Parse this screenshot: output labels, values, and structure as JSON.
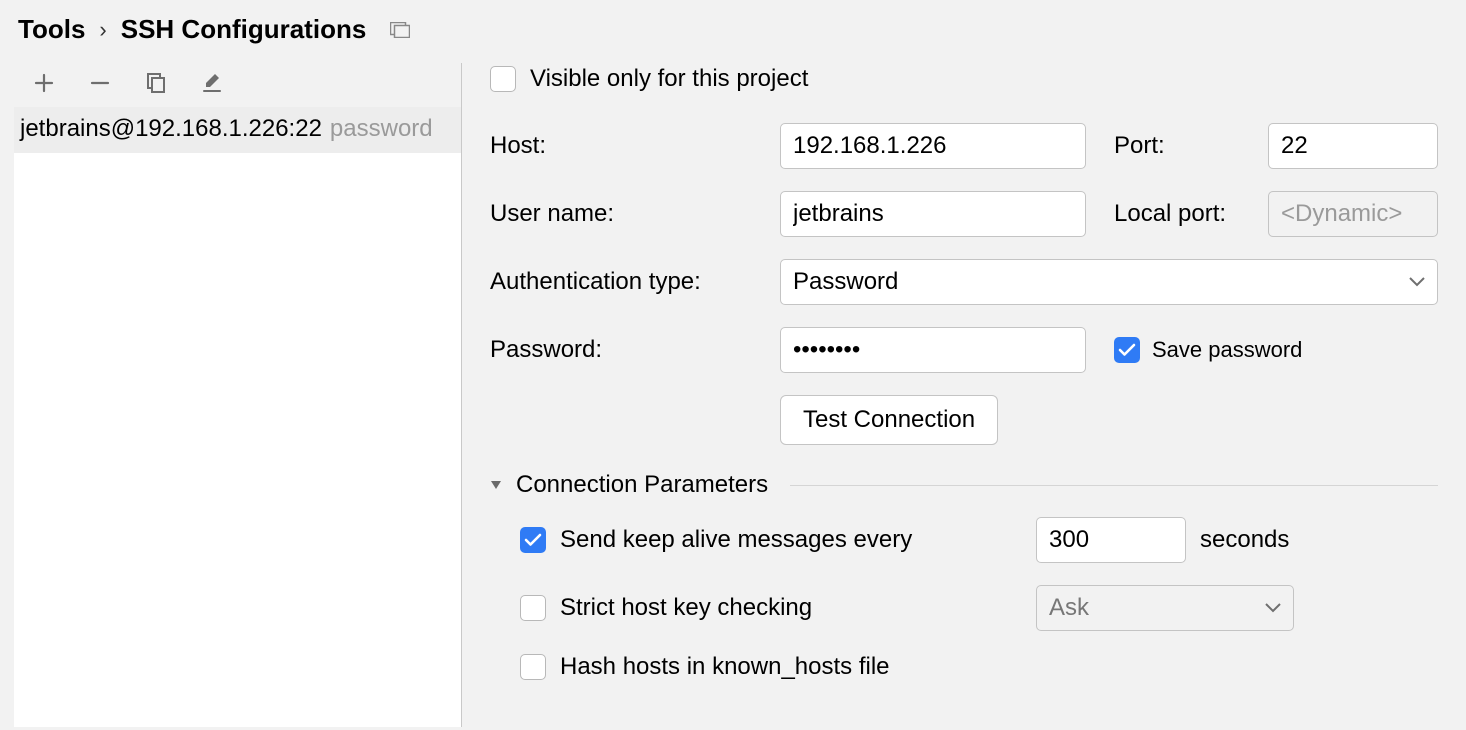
{
  "breadcrumb": {
    "tools": "Tools",
    "page": "SSH Configurations"
  },
  "sidebar": {
    "items": [
      {
        "title": "jetbrains@192.168.1.226:22",
        "auth": "password"
      }
    ]
  },
  "form": {
    "visible_only_label": "Visible only for this project",
    "visible_only_checked": false,
    "host_label": "Host:",
    "host_value": "192.168.1.226",
    "port_label": "Port:",
    "port_value": "22",
    "user_label": "User name:",
    "user_value": "jetbrains",
    "localport_label": "Local port:",
    "localport_placeholder": "<Dynamic>",
    "auth_label": "Authentication type:",
    "auth_value": "Password",
    "password_label": "Password:",
    "password_value": "••••••••",
    "save_password_label": "Save password",
    "save_password_checked": true,
    "test_button": "Test Connection"
  },
  "params": {
    "section_title": "Connection Parameters",
    "keepalive_label": "Send keep alive messages every",
    "keepalive_checked": true,
    "keepalive_value": "300",
    "keepalive_unit": "seconds",
    "strict_label": "Strict host key checking",
    "strict_checked": false,
    "strict_value": "Ask",
    "hash_label": "Hash hosts in known_hosts file",
    "hash_checked": false
  }
}
